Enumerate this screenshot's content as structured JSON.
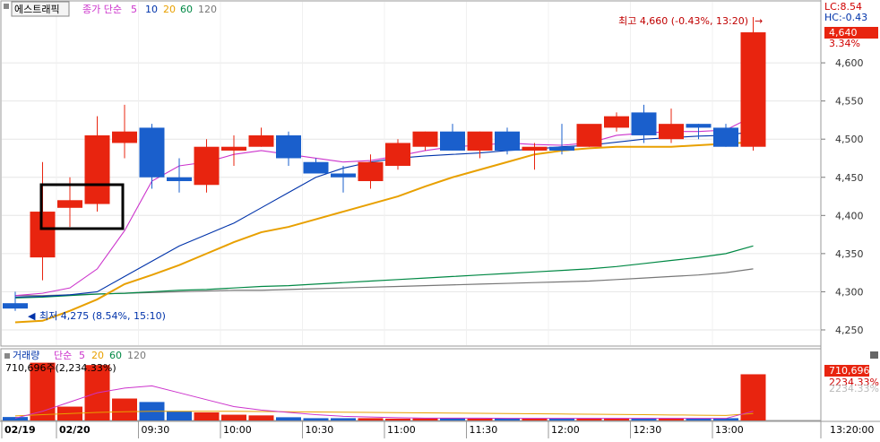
{
  "price_panel": {
    "legend": {
      "name_box": "에스트래픽",
      "ma_prefix": "종가 단순",
      "ma_periods": [
        "5",
        "10",
        "20",
        "60",
        "120"
      ],
      "ma_colors": [
        "#cc33cc",
        "#0033aa",
        "#e8a000",
        "#008844",
        "#777777"
      ]
    },
    "high_note": "최고 4,660 (-0.43%, 13:20)",
    "low_note": "최저 4,275 (8.54%, 15:10)",
    "lc_label": "LC:8.54",
    "hc_label": "HC:-0.43",
    "last_price_badge": "4,640",
    "last_change_pct": "3.34%"
  },
  "volume_panel": {
    "legend": {
      "prefix": "거래량",
      "ma_prefix": "단순",
      "ma_periods": [
        "5",
        "20",
        "60",
        "120"
      ],
      "ma_colors": [
        "#cc33cc",
        "#e8a000",
        "#008844",
        "#777777"
      ]
    },
    "readout": "710,696주(2,234.33%)",
    "badge": "710,696",
    "badge_pct": "2234.33%",
    "badge_pct_ghost": "2234.33%"
  },
  "colors": {
    "up": "#e8240f",
    "down": "#1a5fcc",
    "grid": "#e6e6e6",
    "axis": "#7a7a7a"
  },
  "chart_data": {
    "type": "candlestick",
    "interval": "30m",
    "x_tick_labels": [
      "02/19",
      "02/20",
      "09:30",
      "10:00",
      "10:30",
      "11:00",
      "11:30",
      "12:00",
      "12:30",
      "13:00",
      "13:20:00"
    ],
    "y_tick_labels": [
      "4,250",
      "4,300",
      "4,350",
      "4,400",
      "4,450",
      "4,500",
      "4,550",
      "4,600"
    ],
    "ylim": [
      4230,
      4680
    ],
    "candles": [
      {
        "o": 4285,
        "h": 4300,
        "l": 4275,
        "c": 4278
      },
      {
        "o": 4345,
        "h": 4470,
        "l": 4315,
        "c": 4405
      },
      {
        "o": 4410,
        "h": 4450,
        "l": 4385,
        "c": 4420
      },
      {
        "o": 4415,
        "h": 4530,
        "l": 4405,
        "c": 4505
      },
      {
        "o": 4495,
        "h": 4545,
        "l": 4475,
        "c": 4510
      },
      {
        "o": 4515,
        "h": 4520,
        "l": 4435,
        "c": 4450
      },
      {
        "o": 4450,
        "h": 4475,
        "l": 4430,
        "c": 4445
      },
      {
        "o": 4440,
        "h": 4500,
        "l": 4430,
        "c": 4490
      },
      {
        "o": 4485,
        "h": 4505,
        "l": 4465,
        "c": 4490
      },
      {
        "o": 4490,
        "h": 4515,
        "l": 4490,
        "c": 4505
      },
      {
        "o": 4505,
        "h": 4510,
        "l": 4465,
        "c": 4475
      },
      {
        "o": 4470,
        "h": 4475,
        "l": 4455,
        "c": 4455
      },
      {
        "o": 4455,
        "h": 4465,
        "l": 4430,
        "c": 4450
      },
      {
        "o": 4445,
        "h": 4480,
        "l": 4435,
        "c": 4470
      },
      {
        "o": 4465,
        "h": 4500,
        "l": 4460,
        "c": 4495
      },
      {
        "o": 4490,
        "h": 4510,
        "l": 4485,
        "c": 4510
      },
      {
        "o": 4510,
        "h": 4520,
        "l": 4485,
        "c": 4485
      },
      {
        "o": 4485,
        "h": 4510,
        "l": 4475,
        "c": 4510
      },
      {
        "o": 4510,
        "h": 4515,
        "l": 4480,
        "c": 4485
      },
      {
        "o": 4485,
        "h": 4495,
        "l": 4460,
        "c": 4490
      },
      {
        "o": 4490,
        "h": 4520,
        "l": 4480,
        "c": 4485
      },
      {
        "o": 4490,
        "h": 4515,
        "l": 4490,
        "c": 4520
      },
      {
        "o": 4515,
        "h": 4535,
        "l": 4510,
        "c": 4530
      },
      {
        "o": 4535,
        "h": 4545,
        "l": 4495,
        "c": 4505
      },
      {
        "o": 4500,
        "h": 4540,
        "l": 4495,
        "c": 4520
      },
      {
        "o": 4520,
        "h": 4520,
        "l": 4500,
        "c": 4515
      },
      {
        "o": 4515,
        "h": 4520,
        "l": 4490,
        "c": 4490
      },
      {
        "o": 4490,
        "h": 4660,
        "l": 4485,
        "c": 4640
      }
    ],
    "volume": [
      15,
      250,
      60,
      240,
      95,
      80,
      40,
      35,
      25,
      22,
      14,
      10,
      10,
      10,
      8,
      9,
      10,
      8,
      10,
      8,
      8,
      9,
      8,
      10,
      10,
      8,
      10,
      200
    ],
    "volume_ylim": [
      0,
      260
    ],
    "ma": {
      "ma5": [
        4295,
        4298,
        4305,
        4330,
        4380,
        4445,
        4465,
        4470,
        4480,
        4485,
        4480,
        4475,
        4470,
        4472,
        4478,
        4485,
        4490,
        4492,
        4495,
        4493,
        4492,
        4495,
        4505,
        4508,
        4510,
        4510,
        4512,
        4530
      ],
      "ma10": [
        4293,
        4294,
        4296,
        4300,
        4320,
        4340,
        4360,
        4375,
        4390,
        4410,
        4430,
        4450,
        4462,
        4470,
        4475,
        4478,
        4480,
        4482,
        4485,
        4487,
        4490,
        4492,
        4496,
        4500,
        4502,
        4504,
        4505,
        4510
      ],
      "ma20": [
        4260,
        4262,
        4275,
        4290,
        4310,
        4322,
        4335,
        4350,
        4365,
        4378,
        4385,
        4395,
        4405,
        4415,
        4425,
        4438,
        4450,
        4460,
        4470,
        4480,
        4485,
        4488,
        4490,
        4490,
        4490,
        4492,
        4494,
        4496
      ],
      "ma60": [
        4292,
        4293,
        4295,
        4297,
        4298,
        4300,
        4302,
        4303,
        4305,
        4307,
        4308,
        4310,
        4312,
        4314,
        4316,
        4318,
        4320,
        4322,
        4324,
        4326,
        4328,
        4330,
        4333,
        4337,
        4341,
        4345,
        4350,
        4360
      ],
      "ma120": [
        4295,
        4295,
        4296,
        4297,
        4298,
        4299,
        4300,
        4301,
        4302,
        4302,
        4303,
        4304,
        4305,
        4306,
        4307,
        4308,
        4309,
        4310,
        4311,
        4312,
        4313,
        4314,
        4316,
        4318,
        4320,
        4322,
        4325,
        4330
      ]
    },
    "volume_ma": {
      "ma5": [
        10,
        40,
        80,
        120,
        140,
        150,
        120,
        90,
        60,
        45,
        35,
        25,
        18,
        15,
        12,
        10,
        10,
        10,
        9,
        9,
        9,
        9,
        9,
        9,
        9,
        9,
        9,
        40
      ],
      "ma20": [
        20,
        25,
        30,
        35,
        38,
        40,
        40,
        40,
        40,
        39,
        38,
        37,
        36,
        35,
        34,
        33,
        32,
        31,
        30,
        29,
        28,
        27,
        26,
        25,
        24,
        23,
        22,
        30
      ]
    }
  }
}
